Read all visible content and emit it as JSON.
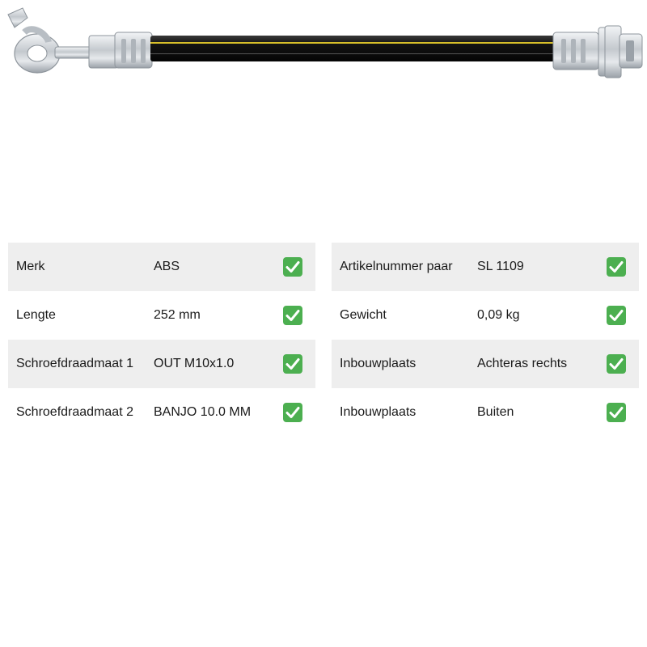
{
  "product": {
    "image": "brake-hose-icon"
  },
  "specs": {
    "left": [
      {
        "label": "Merk",
        "value": "ABS"
      },
      {
        "label": "Lengte",
        "value": "252 mm"
      },
      {
        "label": "Schroefdraadmaat 1",
        "value": "OUT M10x1.0"
      },
      {
        "label": "Schroefdraadmaat 2",
        "value": "BANJO 10.0 MM"
      }
    ],
    "right": [
      {
        "label": "Artikelnummer paar",
        "value": "SL 1109"
      },
      {
        "label": "Gewicht",
        "value": "0,09 kg"
      },
      {
        "label": "Inbouwplaats",
        "value": "Achteras rechts"
      },
      {
        "label": "Inbouwplaats",
        "value": "Buiten"
      }
    ]
  },
  "icons": {
    "check": "check-mark-button-icon"
  },
  "colors": {
    "row_shade": "#eeeeee",
    "check_green": "#4caf50",
    "hose_black": "#1c1c1c",
    "hose_stripe": "#d8c02a",
    "metal": "#c9cdd2"
  }
}
